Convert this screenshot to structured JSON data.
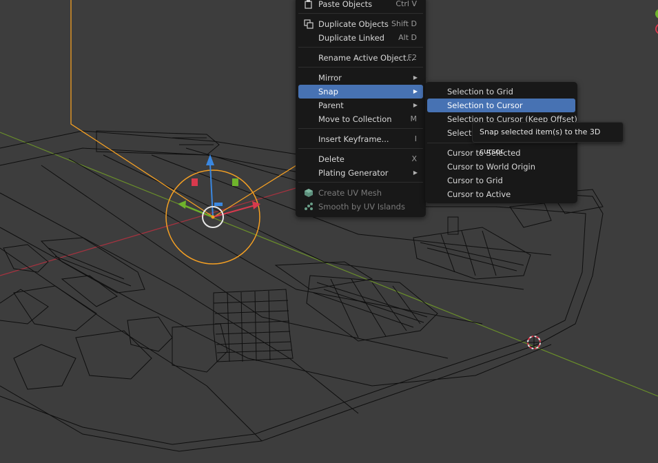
{
  "context_menu": {
    "items": [
      {
        "label": "Paste Objects",
        "shortcut": "Ctrl V",
        "icon": "paste-icon"
      },
      {
        "label": "Duplicate Objects",
        "shortcut": "Shift D",
        "icon": "duplicate-icon"
      },
      {
        "label": "Duplicate Linked",
        "shortcut": "Alt D"
      },
      {
        "label": "Rename Active Object...",
        "shortcut": "F2"
      },
      {
        "label": "Mirror",
        "submenu": true
      },
      {
        "label": "Snap",
        "submenu": true,
        "active": true
      },
      {
        "label": "Parent",
        "submenu": true
      },
      {
        "label": "Move to Collection",
        "shortcut": "M"
      },
      {
        "label": "Insert Keyframe...",
        "shortcut": "I"
      },
      {
        "label": "Delete",
        "shortcut": "X"
      },
      {
        "label": "Plating Generator",
        "submenu": true
      },
      {
        "label": "Create UV Mesh",
        "disabled": true,
        "icon": "uv-mesh-icon"
      },
      {
        "label": "Smooth by UV Islands",
        "disabled": true,
        "icon": "uv-islands-icon"
      }
    ]
  },
  "snap_submenu": {
    "items": [
      {
        "label": "Selection to Grid"
      },
      {
        "label": "Selection to Cursor",
        "active": true
      },
      {
        "label": "Selection to Cursor (Keep Offset)"
      },
      {
        "label": "Selection to Active"
      },
      {
        "label": "Cursor to Selected"
      },
      {
        "label": "Cursor to World Origin"
      },
      {
        "label": "Cursor to Grid"
      },
      {
        "label": "Cursor to Active"
      }
    ]
  },
  "tooltip": {
    "text": "Snap selected item(s) to the 3D cursor."
  },
  "colors": {
    "viewport_bg": "#3d3d3d",
    "x_axis": "#a8323f",
    "y_axis": "#6a8f2a",
    "selection_orange": "#f5a023",
    "menu_bg": "#181818",
    "menu_highlight": "#4772b3",
    "gizmo_blue": "#3a87e0"
  }
}
